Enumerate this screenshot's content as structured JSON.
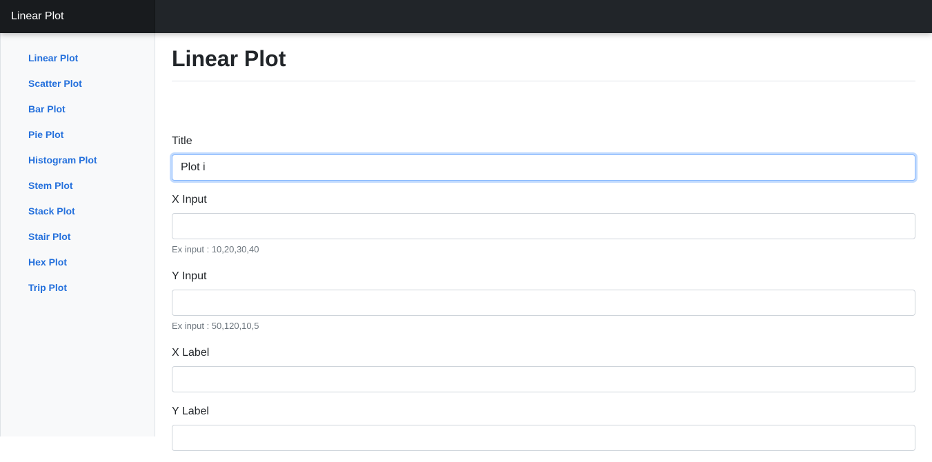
{
  "header": {
    "brand": "Linear Plot"
  },
  "sidebar": {
    "items": [
      {
        "label": "Linear Plot"
      },
      {
        "label": "Scatter Plot"
      },
      {
        "label": "Bar Plot"
      },
      {
        "label": "Pie Plot"
      },
      {
        "label": "Histogram Plot"
      },
      {
        "label": "Stem Plot"
      },
      {
        "label": "Stack Plot"
      },
      {
        "label": "Stair Plot"
      },
      {
        "label": "Hex Plot"
      },
      {
        "label": "Trip Plot"
      }
    ]
  },
  "main": {
    "title": "Linear Plot",
    "form": {
      "title": {
        "label": "Title",
        "value": "Plot i"
      },
      "x_input": {
        "label": "X Input",
        "value": "",
        "help": "Ex input : 10,20,30,40"
      },
      "y_input": {
        "label": "Y Input",
        "value": "",
        "help": "Ex input : 50,120,10,5"
      },
      "x_label": {
        "label": "X Label",
        "value": ""
      },
      "y_label": {
        "label": "Y Label",
        "value": ""
      }
    }
  },
  "colors": {
    "navbar": "#212529",
    "sidebar_bg": "#f8f9fa",
    "link": "#2470dc",
    "focus_border": "#86b7fe"
  }
}
